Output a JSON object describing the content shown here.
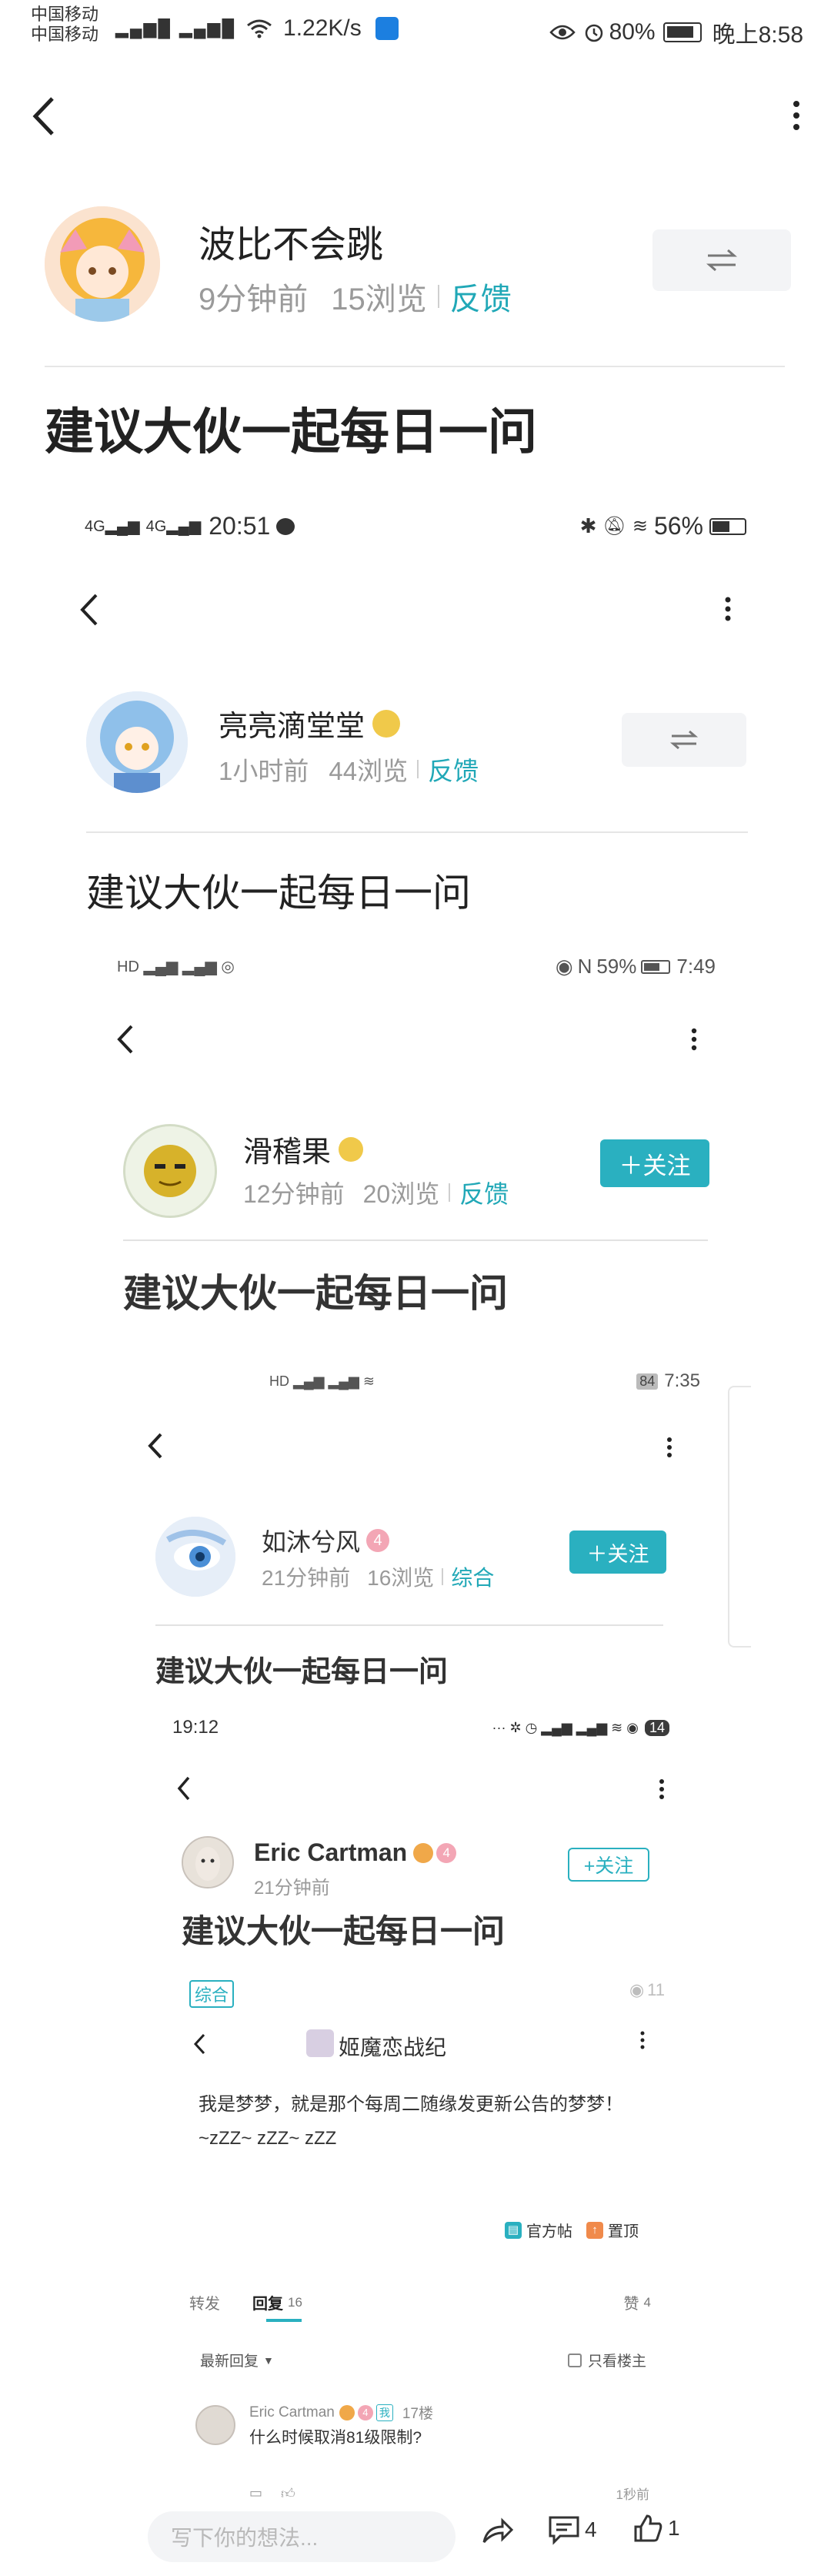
{
  "statusbar": {
    "carrier1": "中国移动",
    "carrier2": "中国移动",
    "speed": "1.22K/s",
    "battery": "80%",
    "time": "晚上8:58"
  },
  "post": {
    "author": "波比不会跳",
    "time_ago": "9分钟前",
    "views": "15浏览",
    "feedback": "反馈",
    "title": "建议大伙一起每日一问"
  },
  "nested1": {
    "status_time": "20:51",
    "battery": "56%",
    "author": "亮亮滴堂堂",
    "time_ago": "1小时前",
    "views": "44浏览",
    "feedback": "反馈",
    "title": "建议大伙一起每日一问"
  },
  "nested2": {
    "status_time": "7:49",
    "battery": "59%",
    "author": "滑稽果",
    "time_ago": "12分钟前",
    "views": "20浏览",
    "feedback": "反馈",
    "follow": "＋关注",
    "title": "建议大伙一起每日一问"
  },
  "nested3": {
    "status_time": "7:35",
    "battery": "84",
    "author": "如沐兮风",
    "level": "4",
    "time_ago": "21分钟前",
    "views": "16浏览",
    "category": "综合",
    "follow": "＋关注",
    "title": "建议大伙一起每日一问"
  },
  "nested4": {
    "status_time": "19:12",
    "battery": "14",
    "author": "Eric Cartman",
    "level": "4",
    "time_ago": "21分钟前",
    "follow": "+关注",
    "title": "建议大伙一起每日一问",
    "tag": "综合",
    "views": "11"
  },
  "inner": {
    "page_title": "姬魔恋战纪",
    "body": "我是梦梦，就是那个每周二随缘发更新公告的梦梦！~zZZ~ zZZ~ zZZ",
    "badge_official": "官方帖",
    "badge_top": "置顶",
    "tab_forward": "转发",
    "tab_reply": "回复",
    "reply_count": "16",
    "tab_like": "赞",
    "like_count": "4",
    "sort": "最新回复",
    "only_op": "只看楼主",
    "comment_author": "Eric Cartman",
    "comment_level": "4",
    "comment_badge": "我",
    "comment_floor": "17楼",
    "comment_text": "什么时候取消81级限制?",
    "comment_time": "1秒前"
  },
  "composer": {
    "placeholder": "写下你的想法...",
    "comment_count": "4",
    "like_count": "1"
  },
  "colors": {
    "accent": "#21a8b7",
    "follow_bg": "#2ab0c0"
  }
}
